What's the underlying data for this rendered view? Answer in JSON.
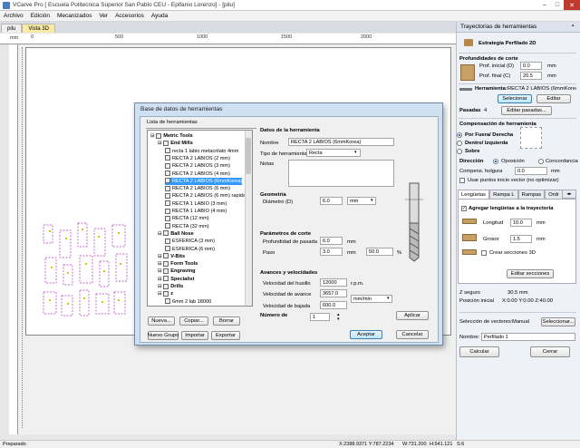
{
  "app": {
    "title": "VCarve Pro [ Escuela Politecnica Superior San Pablo CEU - Epifanio Lorenzo] - [pilu]",
    "min": "–",
    "max": "□",
    "close": "✕"
  },
  "menu": [
    "Archivo",
    "Edición",
    "Mecanizados",
    "Ver",
    "Accesorios",
    "Ayuda"
  ],
  "doc_tabs": [
    "pilu",
    "Vista 3D"
  ],
  "ruler_top": [
    "0",
    "500",
    "1000",
    "1500",
    "2000"
  ],
  "ruler_left_unit": "mm",
  "right": {
    "title": "Trayectorias de herramientas",
    "strategy": "Estrategia Perfilado 2D",
    "depth_heading": "Profundidades de corte",
    "start_label": "Prof. inicial (D)",
    "start_val": "0.0",
    "start_unit": "mm",
    "end_label": "Prof. final (C)",
    "end_val": "20.5",
    "end_unit": "mm",
    "tool_label": "Herramienta:",
    "tool_val": "RECTA 2 LABIOS (6mmKorea)",
    "select_btn": "Selecionar",
    "edit_btn": "Editar",
    "passes_label": "Pasadas",
    "passes_val": "4",
    "edit_passes_btn": "Editar pasadas...",
    "comp_heading": "Compensación de herramienta",
    "comp_opts": [
      "Por Fuera/ Derecha",
      "Dentro/ Izquierda",
      "Sobre"
    ],
    "dir_label": "Dirección",
    "dir_opts": [
      "Oposición",
      "Concordancia"
    ],
    "allow_label": "Compens. holgura",
    "allow_val": "0.0",
    "allow_unit": "mm",
    "plunge_label": "Usar puntos inicio vector (no optimizar)",
    "tabs": [
      "Lengüetas",
      "Rampa L",
      "Rampas",
      "Ordr"
    ],
    "add_tabs": "Agregar lengüetas a la trayectoria",
    "len_label": "Longitud",
    "len_val": "10.0",
    "len_unit": "mm",
    "thick_label": "Grosor",
    "thick_val": "1.5",
    "thick_unit": "mm",
    "create3d": "Crear secciones 3D",
    "edit_sections": "Editar secciones",
    "zsafe": "Z seguro",
    "zsafe_val": "30.5 mm",
    "home": "Posición inicial",
    "home_val": "X:0.00 Y:0.00 Z:40.00",
    "vecsel_label": "Selección de vectores:",
    "vecsel_val": "Manual",
    "vecsel_btn": "Seleccionar...",
    "name_label": "Nombre:",
    "name_val": "Perfilado 1",
    "calc": "Calcular",
    "closebtn": "Cerrar"
  },
  "status": {
    "ready": "Preparado",
    "coords": "X:2388.9371 Y:787.2234",
    "size": "W:731.200",
    "h": "H:541.121",
    "s": "S:6"
  },
  "dialog": {
    "title": "Base de datos de herramientas",
    "list_heading": "Lista de herramientas",
    "tree": [
      {
        "t": "Metric Tools",
        "lvl": 0,
        "bold": true
      },
      {
        "t": "End Mills",
        "lvl": 1,
        "bold": true
      },
      {
        "t": "recta 1 labio metacrilato 4mm",
        "lvl": 2
      },
      {
        "t": "RECTA 2 LABIOS (2 mm)",
        "lvl": 2
      },
      {
        "t": "RECTA 2 LABIOS (3 mm)",
        "lvl": 2
      },
      {
        "t": "RECTA 2 LABIOS (4 mm)",
        "lvl": 2
      },
      {
        "t": "RECTA 2 LABIOS (6mmKorea)",
        "lvl": 2,
        "sel": true
      },
      {
        "t": "RECTA 2 LABIOS (6 mm)",
        "lvl": 2
      },
      {
        "t": "RECTA 2 LABIOS (6 mm) rapida",
        "lvl": 2
      },
      {
        "t": "RECTA 1 LABIO (3 mm)",
        "lvl": 2
      },
      {
        "t": "RECTA 1 LABIO (4 mm)",
        "lvl": 2
      },
      {
        "t": "RECTA (12 mm)",
        "lvl": 2
      },
      {
        "t": "RECTA (32 mm)",
        "lvl": 2
      },
      {
        "t": "Ball Nose",
        "lvl": 1,
        "bold": true
      },
      {
        "t": "ESFERICA (3 mm)",
        "lvl": 2
      },
      {
        "t": "ESFERICA (6 mm)",
        "lvl": 2
      },
      {
        "t": "V-Bits",
        "lvl": 1,
        "bold": true
      },
      {
        "t": "Form Tools",
        "lvl": 1,
        "bold": true
      },
      {
        "t": "Engraving",
        "lvl": 1,
        "bold": true
      },
      {
        "t": "Specialist",
        "lvl": 1,
        "bold": true
      },
      {
        "t": "Drills",
        "lvl": 1,
        "bold": true
      },
      {
        "t": "z",
        "lvl": 1,
        "bold": true
      },
      {
        "t": "6mm 2 lab 18000",
        "lvl": 2
      }
    ],
    "btns": [
      "Nueva...",
      "Copiar...",
      "Borrar",
      "Nuevo Grupo",
      "Importar",
      "Exportar"
    ],
    "tool_data_heading": "Datos de la herramienta",
    "name_label": "Nombre",
    "name_val": "RECTA 2 LABIOS (6mmKorea)",
    "type_label": "Tipo de herramienta",
    "type_val": "Recta",
    "notes_label": "Notas",
    "geom_heading": "Geometría",
    "diam_label": "Diámetro (D)",
    "diam_val": "6.0",
    "diam_unit": "mm",
    "cut_heading": "Parámetros de corte",
    "pass_depth_label": "Profundidad de pasada",
    "pass_depth_val": "6.0",
    "pass_depth_unit": "mm",
    "step_label": "Paso",
    "step_val": "3.0",
    "step_unit": "mm",
    "step_pct": "50.0",
    "pct": "%",
    "feed_heading": "Avances y velocidades",
    "spindle_label": "Velocidad del husillo",
    "spindle_val": "12000",
    "spindle_unit": "r.p.m.",
    "feed_label": "Velocidad de avance",
    "feed_val": "3657.0",
    "feed_unit": "mm/min",
    "plunge_label": "Velocidad de bajada",
    "plunge_val": "600.0",
    "num_label": "Número de",
    "num_val": "1",
    "apply": "Aplicar",
    "ok": "Aceptar",
    "cancel": "Cancelar"
  }
}
